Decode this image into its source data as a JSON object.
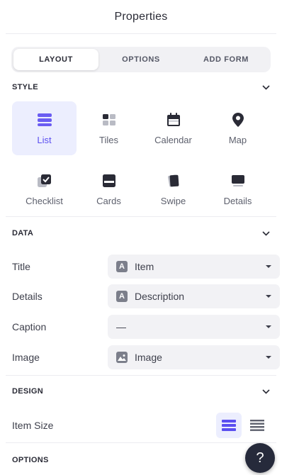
{
  "header": {
    "title": "Properties"
  },
  "tabs": [
    {
      "label": "LAYOUT",
      "active": true
    },
    {
      "label": "OPTIONS",
      "active": false
    },
    {
      "label": "ADD FORM",
      "active": false
    }
  ],
  "style": {
    "heading": "STYLE",
    "items": [
      {
        "label": "List",
        "icon": "list-icon",
        "selected": true
      },
      {
        "label": "Tiles",
        "icon": "tiles-icon"
      },
      {
        "label": "Calendar",
        "icon": "calendar-icon"
      },
      {
        "label": "Map",
        "icon": "map-pin-icon"
      },
      {
        "label": "Checklist",
        "icon": "checklist-icon"
      },
      {
        "label": "Cards",
        "icon": "cards-icon"
      },
      {
        "label": "Swipe",
        "icon": "swipe-icon"
      },
      {
        "label": "Details",
        "icon": "details-icon"
      }
    ]
  },
  "data_section": {
    "heading": "DATA",
    "fields": [
      {
        "label": "Title",
        "value": "Item",
        "icon": "A"
      },
      {
        "label": "Details",
        "value": "Description",
        "icon": "A"
      },
      {
        "label": "Caption",
        "value": "—",
        "icon": ""
      },
      {
        "label": "Image",
        "value": "Image",
        "icon": "image-icon"
      }
    ]
  },
  "design": {
    "heading": "DESIGN",
    "item_size_label": "Item Size",
    "selected_size": "large"
  },
  "options": {
    "heading": "OPTIONS"
  },
  "help": {
    "label": "?"
  },
  "colors": {
    "accent": "#5b4ff0",
    "selected_bg": "#eceefe",
    "field_bg": "#f2f2f5",
    "help_bg": "#262a3b"
  }
}
